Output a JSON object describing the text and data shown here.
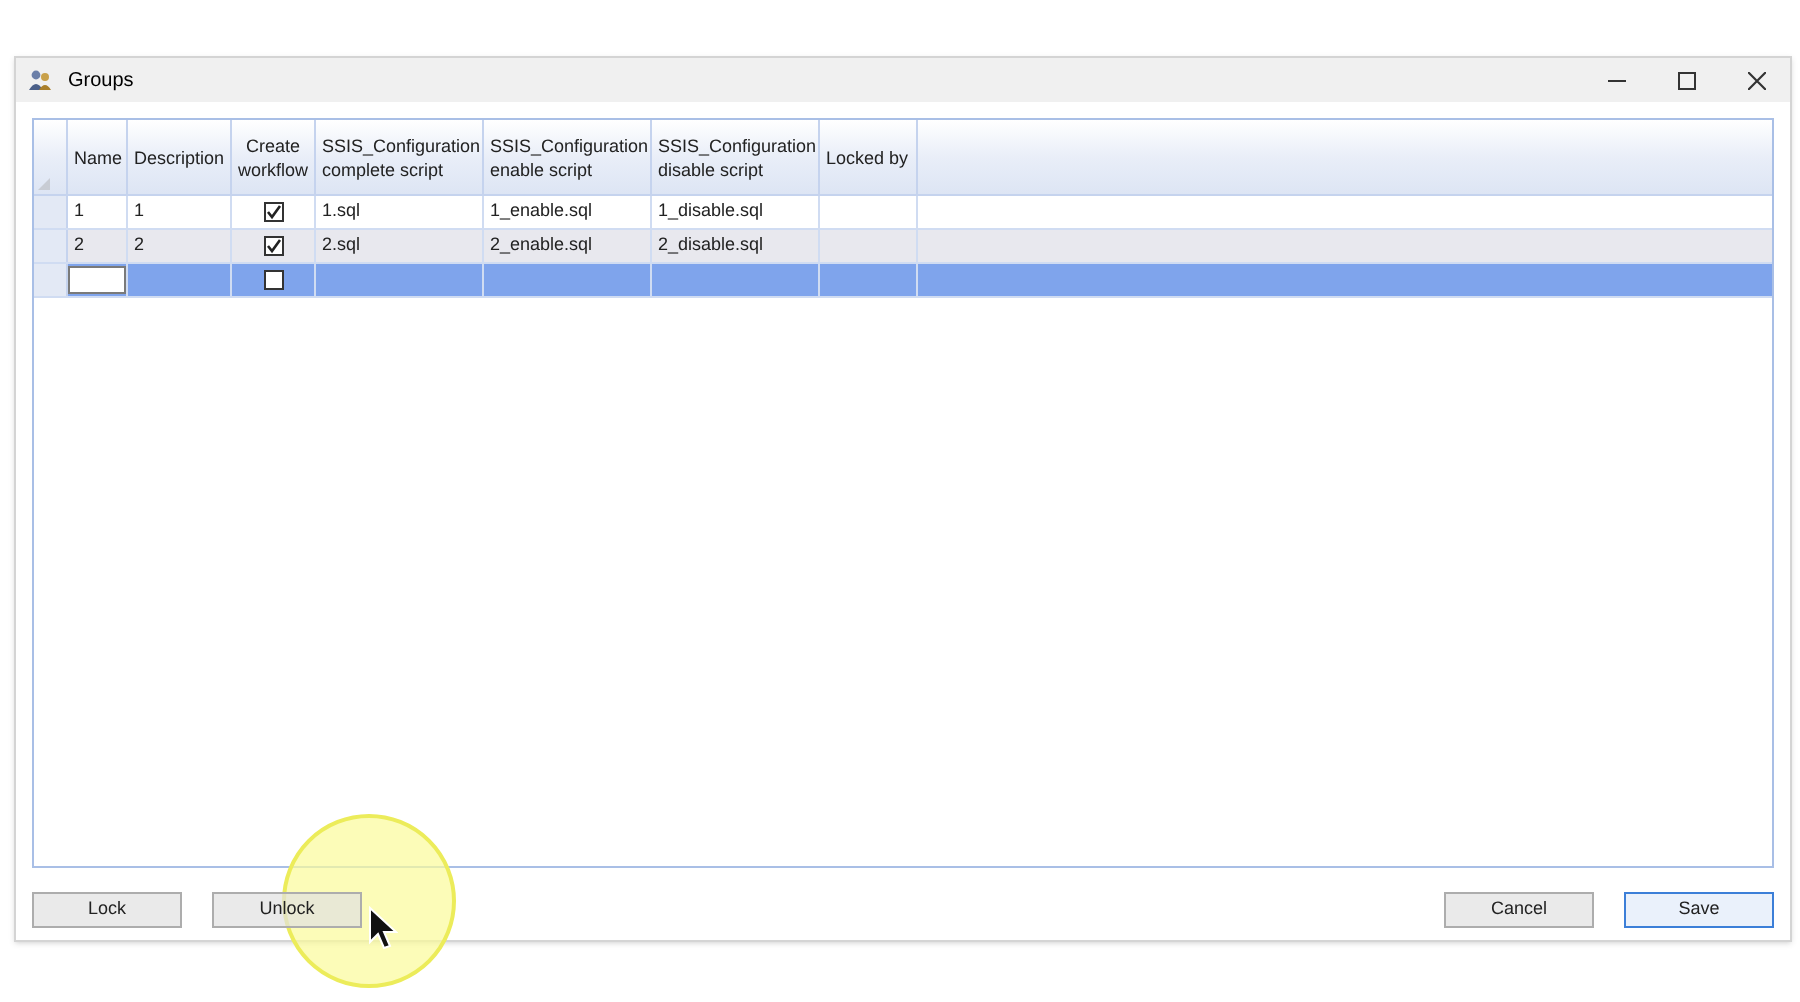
{
  "window": {
    "title": "Groups"
  },
  "table": {
    "columns": [
      {
        "label": "Name",
        "kind": "text"
      },
      {
        "label": "Description",
        "kind": "text"
      },
      {
        "label": "Create workflow",
        "kind": "check"
      },
      {
        "label": "SSIS_Configuration complete script",
        "kind": "text"
      },
      {
        "label": "SSIS_Configuration enable script",
        "kind": "text"
      },
      {
        "label": "SSIS_Configuration disable script",
        "kind": "text"
      },
      {
        "label": "Locked by",
        "kind": "text"
      }
    ],
    "rows": [
      {
        "kind": "data",
        "selected": false,
        "name": "1",
        "description": "1",
        "create_workflow": true,
        "complete_script": "1.sql",
        "enable_script": "1_enable.sql",
        "disable_script": "1_disable.sql"
      },
      {
        "kind": "data",
        "selected": false,
        "name": "2",
        "description": "2",
        "create_workflow": true,
        "complete_script": "2.sql",
        "enable_script": "2_enable.sql",
        "disable_script": "2_disable.sql"
      },
      {
        "kind": "new",
        "selected": true,
        "create_workflow": false
      }
    ]
  },
  "buttons": [
    {
      "label": "Lock",
      "default": false
    },
    {
      "label": "Unlock",
      "default": false
    },
    {
      "label": "Cancel",
      "default": false
    },
    {
      "label": "Save",
      "default": true
    }
  ]
}
